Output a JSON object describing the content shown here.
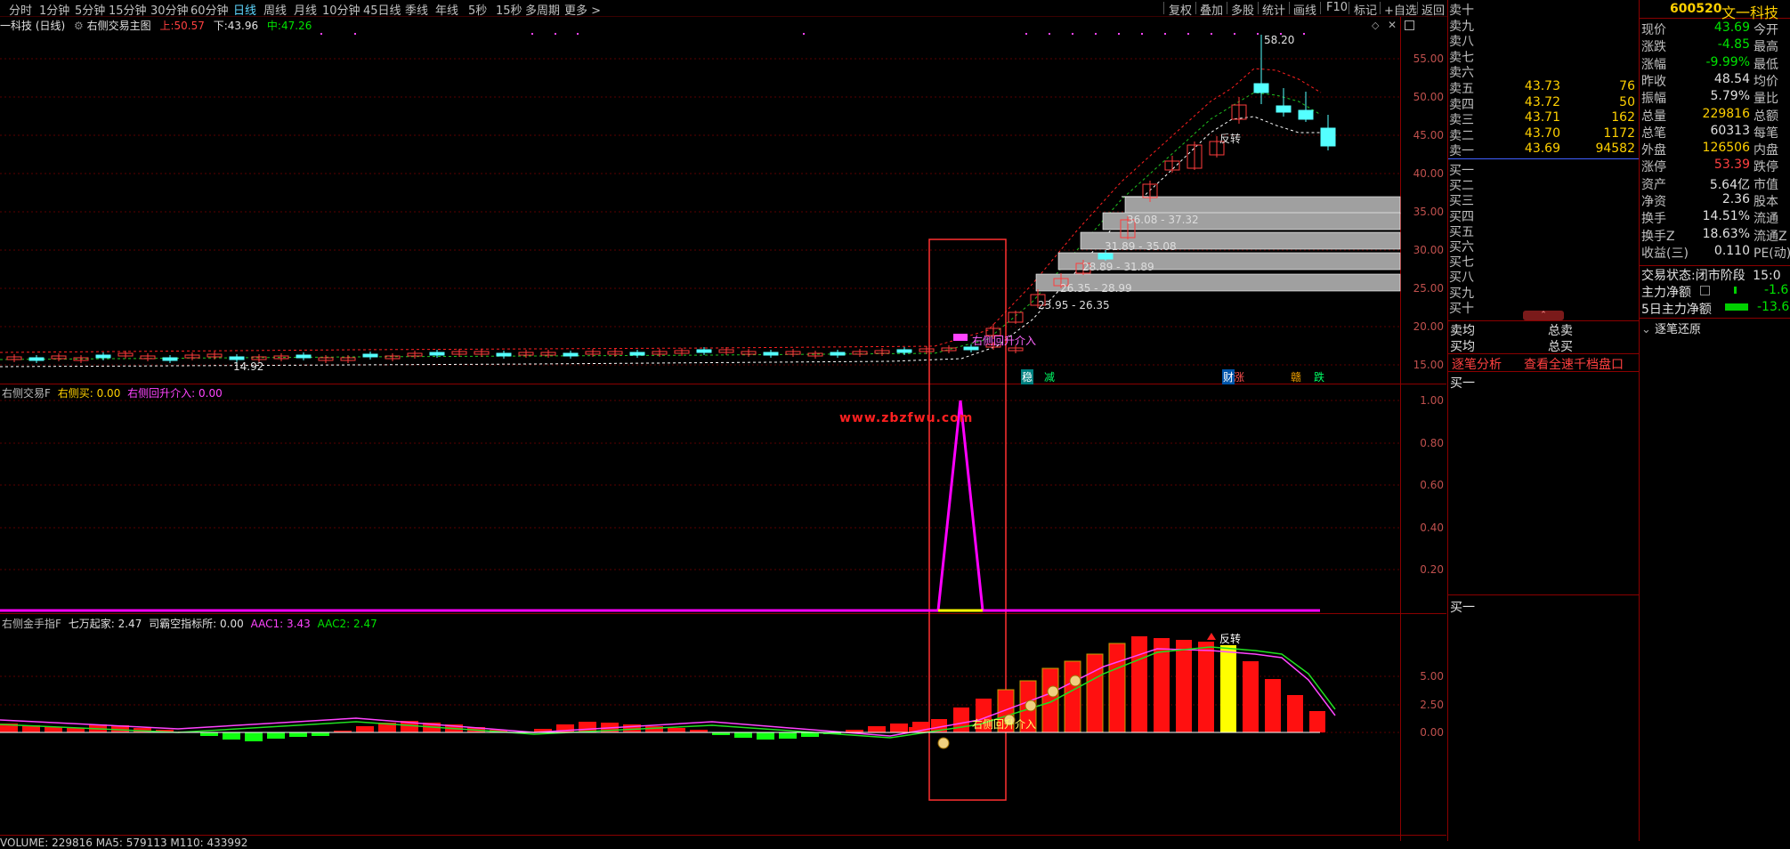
{
  "toolbar": {
    "periods": [
      "分时",
      "1分钟",
      "5分钟",
      "15分钟",
      "30分钟",
      "60分钟",
      "日线",
      "周线",
      "月线",
      "10分钟",
      "45日线",
      "季线",
      "年线",
      "5秒",
      "15秒",
      "多周期",
      "更多 >"
    ],
    "active_period": "日线",
    "right_tools": [
      "复权",
      "叠加",
      "多股",
      "统计",
      "画线",
      "F10",
      "标记",
      "+自选",
      "返回"
    ]
  },
  "main_chart": {
    "title": "一科技 (日线)",
    "indicator_name": "右侧交易主图",
    "up_label": "上:",
    "up_value": "50.57",
    "down_label": "下:",
    "down_value": "43.96",
    "mid_label": "中:",
    "mid_value": "47.26",
    "y_ticks": [
      "55.00",
      "50.00",
      "45.00",
      "40.00",
      "35.00",
      "30.00",
      "25.00",
      "20.00",
      "15.00"
    ],
    "high_annotation": "58.20",
    "low_annotation": "14.92",
    "reversal_label": "反转",
    "entry_label": "右侧回升介入",
    "price_zones": [
      "36.08 - 37.32",
      "31.89 - 35.08",
      "28.89 - 31.89",
      "26.35 - 28.99",
      "23.95 - 26.35"
    ],
    "bottom_tags": [
      "稳",
      "减",
      "财",
      "涨",
      "赣",
      "跌"
    ]
  },
  "sub1": {
    "name": "右侧交易F",
    "item1_label": "右侧买:",
    "item1_value": "0.00",
    "item2_label": "右侧回升介入:",
    "item2_value": "0.00",
    "y_ticks": [
      "1.00",
      "0.80",
      "0.60",
      "0.40",
      "0.20"
    ],
    "watermark": "www.zbzfwu.com"
  },
  "sub2": {
    "name": "右侧金手指F",
    "item1_label": "七万起家:",
    "item1_value": "2.47",
    "item2_label": "司霸空指标所:",
    "item2_value": "0.00",
    "item3_label": "AAC1:",
    "item3_value": "3.43",
    "item4_label": "AAC2:",
    "item4_value": "2.47",
    "y_ticks": [
      "5.00",
      "2.50",
      "0.00"
    ],
    "reversal_label": "反转",
    "entry_label": "右侧回升介入"
  },
  "volume_bar": {
    "text": "VOLUME: 229816  MA5: 579113  M110: 433992"
  },
  "quote": {
    "code": "600520",
    "name": "文一科技",
    "sell_labels": [
      "卖十",
      "卖九",
      "卖八",
      "卖七",
      "卖六",
      "卖五",
      "卖四",
      "卖三",
      "卖二",
      "卖一"
    ],
    "sell_prices": [
      "",
      "",
      "",
      "",
      "",
      "43.73",
      "43.72",
      "43.71",
      "43.70",
      "43.69"
    ],
    "sell_vols": [
      "",
      "",
      "",
      "",
      "",
      "76",
      "50",
      "162",
      "1172",
      "94582"
    ],
    "buy_labels": [
      "买一",
      "买二",
      "买三",
      "买四",
      "买五",
      "买六",
      "买七",
      "买八",
      "买九",
      "买十"
    ],
    "stats": [
      {
        "label": "现价",
        "value": "43.69",
        "label2": "今开"
      },
      {
        "label": "涨跌",
        "value": "-4.85",
        "label2": "最高"
      },
      {
        "label": "涨幅",
        "value": "-9.99%",
        "label2": "最低"
      },
      {
        "label": "昨收",
        "value": "48.54",
        "label2": "均价"
      },
      {
        "label": "振幅",
        "value": "5.79%",
        "label2": "量比"
      },
      {
        "label": "总量",
        "value": "229816",
        "label2": "总额"
      },
      {
        "label": "总笔",
        "value": "60313",
        "label2": "每笔"
      },
      {
        "label": "外盘",
        "value": "126506",
        "label2": "内盘"
      },
      {
        "label": "涨停",
        "value": "53.39",
        "label2": "跌停"
      },
      {
        "label": "资产",
        "value": "5.64亿",
        "label2": "市值"
      },
      {
        "label": "净资",
        "value": "2.36",
        "label2": "股本"
      },
      {
        "label": "换手",
        "value": "14.51%",
        "label2": "流通"
      },
      {
        "label": "换手Z",
        "value": "18.63%",
        "label2": "流通Z"
      },
      {
        "label": "收益(三)",
        "value": "0.110",
        "label2": "PE(动)"
      }
    ],
    "trade_status_label": "交易状态:",
    "trade_status_value": "闭市阶段",
    "trade_status_time": "15:0",
    "main_net_label": "主力净额",
    "main_net_value": "-1.6",
    "main_net5_label": "5日主力净额",
    "main_net5_value": "-13.6",
    "avg_sell_label": "卖均",
    "total_sell_label": "总卖",
    "avg_buy_label": "买均",
    "total_buy_label": "总买",
    "tick_analysis": "逐笔分析",
    "full_depth": "查看全速千档盘口",
    "buy_one_1": "买一",
    "buy_one_2": "买一",
    "tick_restore": "逐笔还原"
  },
  "colors": {
    "bg": "#000000",
    "grid": "#8b0000",
    "up": "#ff3c3c",
    "down": "#54ffff",
    "magenta": "#ff00ff",
    "yellow": "#ffff00",
    "green": "#00e400"
  }
}
